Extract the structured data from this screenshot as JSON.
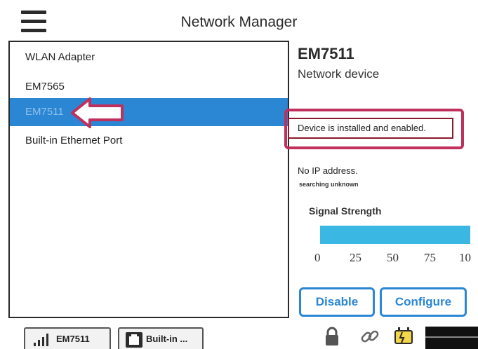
{
  "header": {
    "title": "Network Manager",
    "menu_icon": "hamburger-menu-icon"
  },
  "devices": [
    {
      "label": "WLAN Adapter",
      "selected": false
    },
    {
      "label": "EM7565",
      "selected": false
    },
    {
      "label": "EM7511",
      "selected": true
    },
    {
      "label": "Built-in Ethernet Port",
      "selected": false
    }
  ],
  "detail": {
    "name": "EM7511",
    "type": "Network device",
    "status": "Device is installed and enabled.",
    "ip": "No IP address.",
    "searching": "searching unknown",
    "signal_label": "Signal Strength",
    "signal_percent": 100,
    "signal_ticks": [
      "0",
      "25",
      "50",
      "75",
      "10"
    ]
  },
  "buttons": {
    "disable": "Disable",
    "configure": "Configure"
  },
  "statusbar": {
    "tabs": [
      {
        "label": "EM7511",
        "icon": "signal-bars-icon"
      },
      {
        "label": "Built-in ...",
        "icon": "ethernet-port-icon"
      }
    ],
    "icons": [
      "lock-icon",
      "link-icon",
      "power-plug-icon"
    ]
  },
  "colors": {
    "accent": "#2b86d4",
    "highlight": "#c0305c",
    "signal": "#3ab7e3"
  }
}
